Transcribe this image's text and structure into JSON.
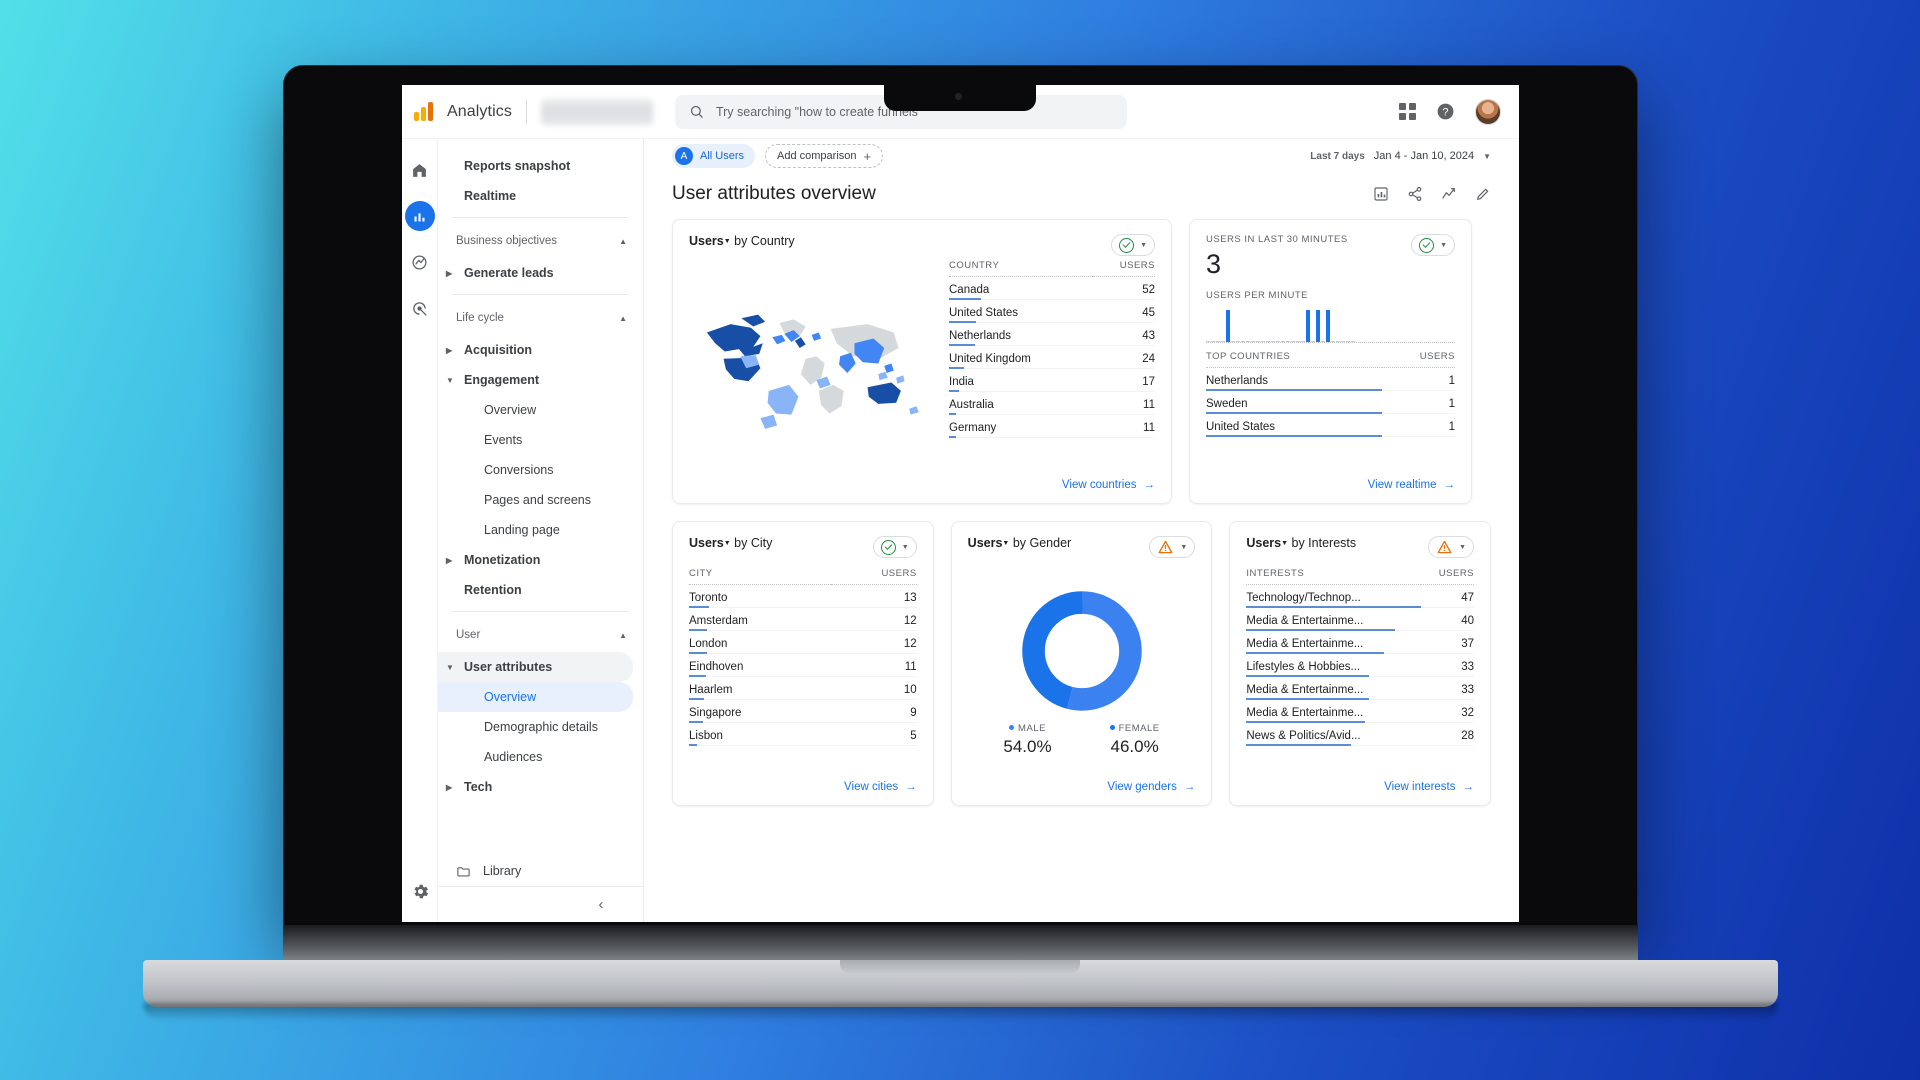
{
  "app": {
    "brand": "Analytics",
    "search_placeholder": "Try searching \"how to create funnels\"",
    "icons": {
      "search": "search-icon",
      "apps": "apps-grid-icon",
      "help": "help-icon",
      "avatar": "user-avatar"
    }
  },
  "rail": [
    {
      "name": "home",
      "icon": "home-icon",
      "active": false
    },
    {
      "name": "reports",
      "icon": "bar-chart-icon",
      "active": true
    },
    {
      "name": "explore",
      "icon": "explore-icon",
      "active": false
    },
    {
      "name": "advertising",
      "icon": "advertising-icon",
      "active": false
    }
  ],
  "nav": {
    "top_items": [
      {
        "label": "Reports snapshot",
        "selected": false
      },
      {
        "label": "Realtime",
        "selected": false
      }
    ],
    "sections": [
      {
        "heading": "Business objectives",
        "collapsible": true,
        "items": [
          {
            "label": "Generate leads",
            "level": 1,
            "caret": "right"
          }
        ]
      },
      {
        "heading": "Life cycle",
        "collapsible": true,
        "items": [
          {
            "label": "Acquisition",
            "level": 1,
            "caret": "right"
          },
          {
            "label": "Engagement",
            "level": 1,
            "caret": "down"
          },
          {
            "label": "Overview",
            "level": 2,
            "caret": "none"
          },
          {
            "label": "Events",
            "level": 2,
            "caret": "none"
          },
          {
            "label": "Conversions",
            "level": 2,
            "caret": "none"
          },
          {
            "label": "Pages and screens",
            "level": 2,
            "caret": "none"
          },
          {
            "label": "Landing page",
            "level": 2,
            "caret": "none"
          },
          {
            "label": "Monetization",
            "level": 1,
            "caret": "right"
          },
          {
            "label": "Retention",
            "level": 1,
            "caret": "none"
          }
        ]
      },
      {
        "heading": "User",
        "collapsible": true,
        "items": [
          {
            "label": "User attributes",
            "level": 1,
            "caret": "down",
            "active_parent": true
          },
          {
            "label": "Overview",
            "level": 2,
            "caret": "none",
            "selected": true
          },
          {
            "label": "Demographic details",
            "level": 2,
            "caret": "none"
          },
          {
            "label": "Audiences",
            "level": 2,
            "caret": "none"
          },
          {
            "label": "Tech",
            "level": 1,
            "caret": "right"
          }
        ]
      }
    ],
    "library": "Library",
    "collapse_icon": "chevron-left-icon",
    "settings_icon": "gear-icon"
  },
  "comparison_bar": {
    "all_users": "All Users",
    "all_users_initial": "A",
    "add_comparison": "Add comparison",
    "date_label": "Last 7 days",
    "date_range": "Jan 4 - Jan 10, 2024"
  },
  "page": {
    "title": "User attributes overview",
    "actions": [
      {
        "name": "insights-icon"
      },
      {
        "name": "share-icon"
      },
      {
        "name": "compare-trend-icon"
      },
      {
        "name": "edit-pencil-icon"
      }
    ]
  },
  "colors": {
    "accent_blue": "#1a73e8",
    "map_dark": "#174ea6",
    "map_mid": "#4285f4",
    "map_light": "#8ab4f8",
    "map_none": "#d6d9dc",
    "bar_blue": "#5b8dd4",
    "ok_green": "#1e8e3e",
    "warn_orange": "#e8710a"
  },
  "chart_data": [
    {
      "type": "table",
      "id": "users-by-country",
      "title_prefix": "Users",
      "title_suffix": " by Country",
      "status": "ok",
      "map": true,
      "columns": [
        "COUNTRY",
        "USERS"
      ],
      "categories": [
        "Canada",
        "United States",
        "Netherlands",
        "United Kingdom",
        "India",
        "Australia",
        "Germany"
      ],
      "values": [
        52,
        45,
        43,
        24,
        17,
        11,
        11
      ],
      "link": "View countries"
    },
    {
      "type": "bar",
      "id": "users-last-30-min",
      "status": "ok",
      "headline_label": "USERS IN LAST 30 MINUTES",
      "headline_value": "3",
      "sub_label": "USERS PER MINUTE",
      "xlabel": "minute",
      "ylabel": "users",
      "x": [
        0,
        1,
        2,
        3,
        4,
        5,
        6,
        7,
        8,
        9,
        10,
        11,
        12,
        13,
        14,
        15,
        16,
        17,
        18,
        19,
        20,
        21,
        22,
        23,
        24,
        25,
        26,
        27,
        28,
        29
      ],
      "values": [
        0,
        0,
        0,
        0,
        1,
        0,
        0,
        0,
        0,
        0,
        0,
        0,
        0,
        0,
        0,
        0,
        0,
        0,
        0,
        0,
        1,
        0,
        1,
        0,
        1,
        0,
        0,
        0,
        0,
        0
      ],
      "top_columns": [
        "TOP COUNTRIES",
        "USERS"
      ],
      "top_categories": [
        "Netherlands",
        "Sweden",
        "United States"
      ],
      "top_values": [
        1,
        1,
        1
      ],
      "link": "View realtime"
    },
    {
      "type": "table",
      "id": "users-by-city",
      "title_prefix": "Users",
      "title_suffix": " by City",
      "status": "ok",
      "columns": [
        "CITY",
        "USERS"
      ],
      "categories": [
        "Toronto",
        "Amsterdam",
        "London",
        "Eindhoven",
        "Haarlem",
        "Singapore",
        "Lisbon"
      ],
      "values": [
        13,
        12,
        12,
        11,
        10,
        9,
        5
      ],
      "link": "View cities"
    },
    {
      "type": "pie",
      "id": "users-by-gender",
      "title_prefix": "Users",
      "title_suffix": " by Gender",
      "status": "warn",
      "labels": [
        "MALE",
        "FEMALE"
      ],
      "values": [
        54.0,
        46.0
      ],
      "display_values": [
        "54.0%",
        "46.0%"
      ],
      "slice_colors": [
        "#1a73e8",
        "#3b82f0"
      ],
      "link": "View genders"
    },
    {
      "type": "table",
      "id": "users-by-interests",
      "title_prefix": "Users",
      "title_suffix": " by Interests",
      "status": "warn",
      "columns": [
        "INTERESTS",
        "USERS"
      ],
      "categories": [
        "Technology/Technop...",
        "Media & Entertainme...",
        "Media & Entertainme...",
        "Lifestyles & Hobbies...",
        "Media & Entertainme...",
        "Media & Entertainme...",
        "News & Politics/Avid..."
      ],
      "values": [
        47,
        40,
        37,
        33,
        33,
        32,
        28
      ],
      "link": "View interests"
    }
  ]
}
